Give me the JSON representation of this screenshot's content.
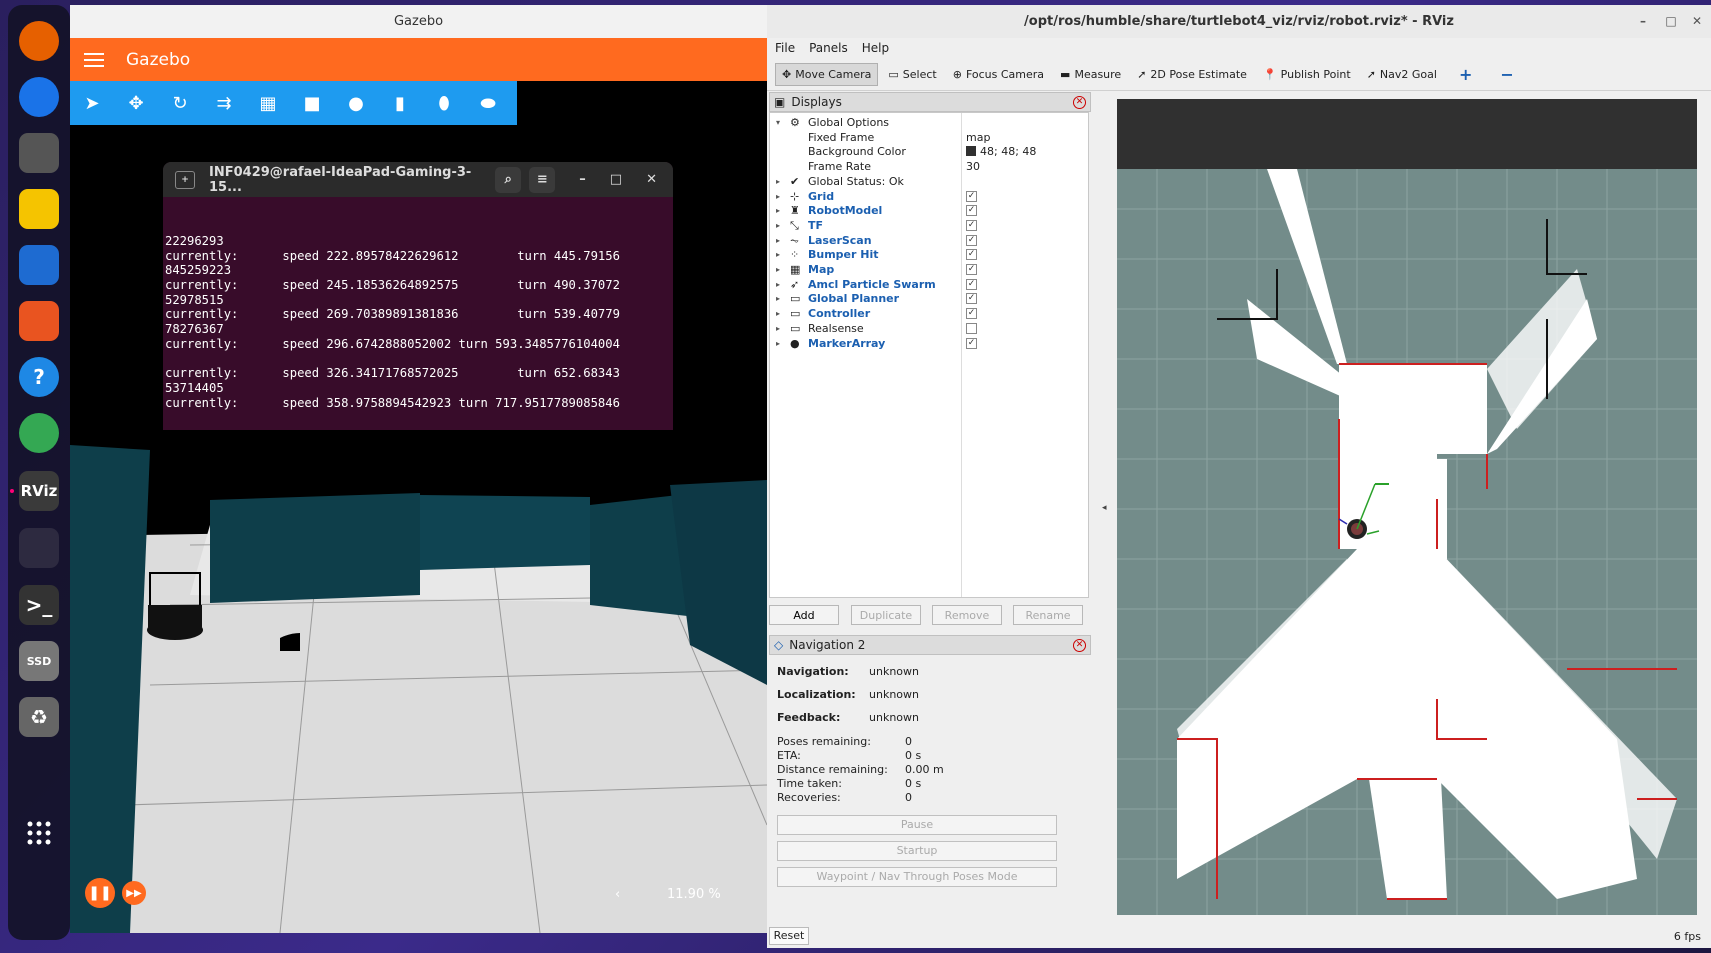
{
  "dock": {
    "items": [
      {
        "name": "firefox-icon",
        "glyph": "",
        "color": "#e66000"
      },
      {
        "name": "thunderbird-icon",
        "glyph": "",
        "color": "#1a73e8"
      },
      {
        "name": "files-icon",
        "glyph": "",
        "color": "#555"
      },
      {
        "name": "rhythmbox-icon",
        "glyph": "",
        "color": "#f5c400"
      },
      {
        "name": "writer-icon",
        "glyph": "",
        "color": "#1e6bd1"
      },
      {
        "name": "app-center-icon",
        "glyph": "",
        "color": "#e95420"
      },
      {
        "name": "help-icon",
        "glyph": "?",
        "color": "#1e88e5"
      },
      {
        "name": "chrome-icon",
        "glyph": "",
        "color": "#34a853"
      },
      {
        "name": "rviz-icon",
        "glyph": "RViz",
        "color": "#3a3a3a"
      },
      {
        "name": "gazebo-icon",
        "glyph": "",
        "color": "#2d2a40"
      },
      {
        "name": "terminal-icon",
        "glyph": ">_",
        "color": "#333"
      },
      {
        "name": "ssd-icon",
        "glyph": "SSD",
        "color": "#777"
      },
      {
        "name": "trash-icon",
        "glyph": "♻",
        "color": "#666"
      },
      {
        "name": "show-apps-icon",
        "glyph": "",
        "color": "transparent"
      }
    ]
  },
  "gazebo": {
    "window_title": "Gazebo",
    "header_title": "Gazebo",
    "zoom_text": "11.90 %",
    "zoom_arrow": "‹"
  },
  "terminal": {
    "title": "INF0429@rafael-IdeaPad-Gaming-3-15...",
    "lines": [
      "22296293",
      "currently:      speed 222.89578422629612        turn 445.79156",
      "845259223",
      "currently:      speed 245.18536264892575        turn 490.37072",
      "52978515",
      "currently:      speed 269.70389891381836        turn 539.40779",
      "78276367",
      "currently:      speed 296.6742888052002 turn 593.3485776104004",
      "",
      "currently:      speed 326.34171768572025        turn 652.68343",
      "53714405",
      "currently:      speed 358.9758894542923 turn 717.9517789085846"
    ]
  },
  "rviz": {
    "window_title": "/opt/ros/humble/share/turtlebot4_viz/rviz/robot.rviz* - RViz",
    "menu": [
      "File",
      "Panels",
      "Help"
    ],
    "tools": [
      {
        "label": "Move Camera",
        "active": true,
        "icon": "✥"
      },
      {
        "label": "Select",
        "active": false,
        "icon": "▭"
      },
      {
        "label": "Focus Camera",
        "active": false,
        "icon": "⊕"
      },
      {
        "label": "Measure",
        "active": false,
        "icon": "▬"
      },
      {
        "label": "2D Pose Estimate",
        "active": false,
        "icon": "➚"
      },
      {
        "label": "Publish Point",
        "active": false,
        "icon": "📍"
      },
      {
        "label": "Nav2 Goal",
        "active": false,
        "icon": "➚"
      }
    ],
    "add_tool": "+",
    "remove_tool": "−",
    "displays": {
      "title": "Displays",
      "rows": [
        {
          "name": "Global Options",
          "icon": "⚙",
          "expanded": true,
          "blue": false,
          "value": ""
        },
        {
          "name": "Fixed Frame",
          "sub": true,
          "value": "map"
        },
        {
          "name": "Background Color",
          "sub": true,
          "value": "48; 48; 48",
          "swatch": "#303030"
        },
        {
          "name": "Frame Rate",
          "sub": true,
          "value": "30"
        },
        {
          "name": "Global Status: Ok",
          "icon": "✔",
          "blue": false,
          "value": ""
        },
        {
          "name": "Grid",
          "icon": "⊹",
          "blue": true,
          "checked": true
        },
        {
          "name": "RobotModel",
          "icon": "♜",
          "blue": true,
          "checked": true
        },
        {
          "name": "TF",
          "icon": "⤡",
          "blue": true,
          "checked": true
        },
        {
          "name": "LaserScan",
          "icon": "⏦",
          "blue": true,
          "checked": true
        },
        {
          "name": "Bumper Hit",
          "icon": "⁘",
          "blue": true,
          "checked": true
        },
        {
          "name": "Map",
          "icon": "▦",
          "blue": true,
          "checked": true
        },
        {
          "name": "Amcl Particle Swarm",
          "icon": "➶",
          "blue": true,
          "checked": true
        },
        {
          "name": "Global Planner",
          "icon": "▭",
          "blue": true,
          "checked": true
        },
        {
          "name": "Controller",
          "icon": "▭",
          "blue": true,
          "checked": true
        },
        {
          "name": "Realsense",
          "icon": "▭",
          "blue": false,
          "checked": false
        },
        {
          "name": "MarkerArray",
          "icon": "●",
          "blue": true,
          "checked": true
        }
      ],
      "buttons": [
        {
          "label": "Add",
          "disabled": false
        },
        {
          "label": "Duplicate",
          "disabled": true
        },
        {
          "label": "Remove",
          "disabled": true
        },
        {
          "label": "Rename",
          "disabled": true
        }
      ]
    },
    "nav2": {
      "title": "Navigation 2",
      "status": [
        {
          "label": "Navigation:",
          "value": "unknown"
        },
        {
          "label": "Localization:",
          "value": "unknown"
        },
        {
          "label": "Feedback:",
          "value": "unknown"
        }
      ],
      "stats": [
        {
          "label": "Poses remaining:",
          "value": "0"
        },
        {
          "label": "ETA:",
          "value": "0 s"
        },
        {
          "label": "Distance remaining:",
          "value": "0.00 m"
        },
        {
          "label": "Time taken:",
          "value": "0 s"
        },
        {
          "label": "Recoveries:",
          "value": "0"
        }
      ],
      "buttons": [
        "Pause",
        "Startup",
        "Waypoint / Nav Through Poses Mode"
      ]
    },
    "reset_label": "Reset",
    "fps": "6 fps"
  }
}
